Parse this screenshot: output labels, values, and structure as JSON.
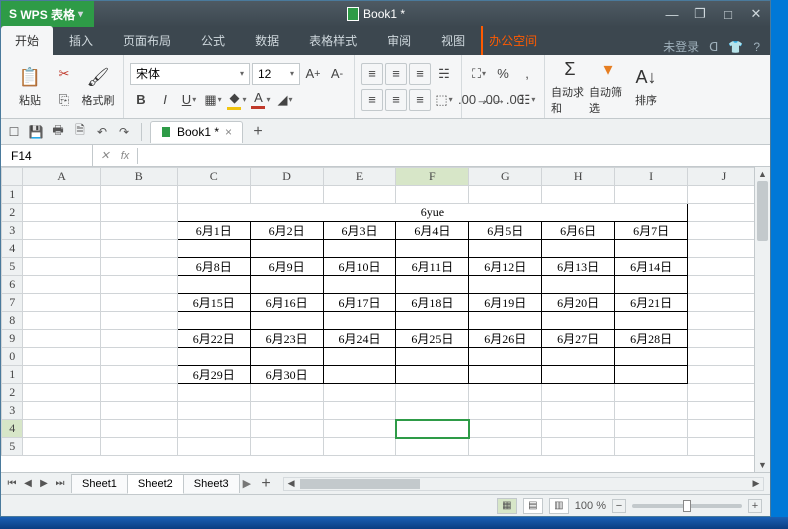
{
  "app": {
    "name": "WPS 表格",
    "doc_title": "Book1 *"
  },
  "winctrl": {
    "min": "—",
    "restore": "❐",
    "max": "□",
    "close": "✕"
  },
  "ribbon_tabs": [
    "开始",
    "插入",
    "页面布局",
    "公式",
    "数据",
    "表格样式",
    "审阅",
    "视图",
    "办公空间"
  ],
  "ribbon_right": {
    "login": "未登录",
    "skin": "ᗡ",
    "shirt": "👕",
    "help": "?"
  },
  "clipboard": {
    "paste": "粘贴",
    "format": "格式刷",
    "cut": "✂",
    "copy": "⎘"
  },
  "font": {
    "family": "宋体",
    "size": "12"
  },
  "bigbtns": {
    "sum": "自动求和",
    "filter": "自动筛选",
    "sort": "排序"
  },
  "doctab": {
    "name": "Book1 *"
  },
  "formula": {
    "cell": "F14",
    "fx": "fx",
    "value": ""
  },
  "columns": [
    "A",
    "B",
    "C",
    "D",
    "E",
    "F",
    "G",
    "H",
    "I",
    "J"
  ],
  "rows_visible": [
    "1",
    "2",
    "3",
    "4",
    "5",
    "6",
    "7",
    "8",
    "9",
    "0",
    "1",
    "2",
    "3",
    "4",
    "5"
  ],
  "table_title": "6yue",
  "cal": {
    "r3": [
      "6月1日",
      "6月2日",
      "6月3日",
      "6月4日",
      "6月5日",
      "6月6日",
      "6月7日"
    ],
    "r5": [
      "6月8日",
      "6月9日",
      "6月10日",
      "6月11日",
      "6月12日",
      "6月13日",
      "6月14日"
    ],
    "r7": [
      "6月15日",
      "6月16日",
      "6月17日",
      "6月18日",
      "6月19日",
      "6月20日",
      "6月21日"
    ],
    "r9": [
      "6月22日",
      "6月23日",
      "6月24日",
      "6月25日",
      "6月26日",
      "6月27日",
      "6月28日"
    ],
    "r11": [
      "6月29日",
      "6月30日",
      "",
      "",
      "",
      "",
      ""
    ]
  },
  "sheets": [
    "Sheet1",
    "Sheet2",
    "Sheet3"
  ],
  "status": {
    "zoom": "100 %"
  }
}
